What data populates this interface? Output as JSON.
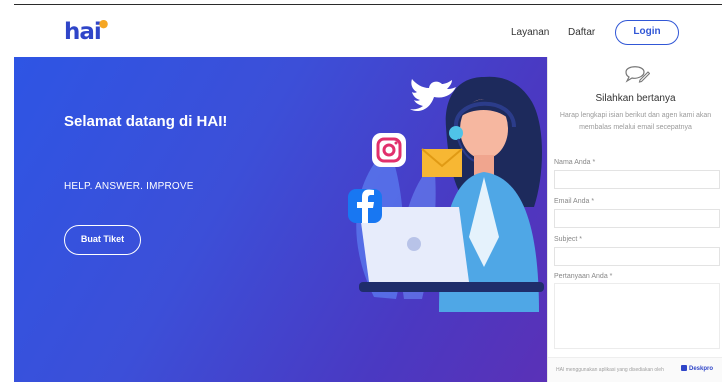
{
  "header": {
    "logo_text": "hai",
    "nav": [
      "Layanan",
      "Daftar"
    ],
    "login_label": "Login"
  },
  "hero": {
    "title": "Selamat datang di HAI!",
    "tagline": "HELP. ANSWER. IMPROVE",
    "ticket_button": "Buat Tiket"
  },
  "form": {
    "title": "Silahkan bertanya",
    "description": "Harap lengkapi isian berikut dan agen kami akan membalas melalui email secepatnya",
    "fields": [
      {
        "label": "Nama Anda *"
      },
      {
        "label": "Email Anda *"
      },
      {
        "label": "Subject *"
      },
      {
        "label": "Pertanyaan Anda *"
      }
    ],
    "footer_text": "HAI menggunakan aplikasi yang disediakan oleh",
    "footer_brand": "Deskpro"
  },
  "colors": {
    "brand_blue": "#2f45c8",
    "accent_yellow": "#f5a623",
    "hero_start": "#2e55e4",
    "hero_end": "#5a31b7"
  },
  "icons": [
    "chat-bubble-pencil-icon",
    "twitter-icon",
    "instagram-icon",
    "mail-icon",
    "facebook-icon",
    "laptop-icon"
  ]
}
